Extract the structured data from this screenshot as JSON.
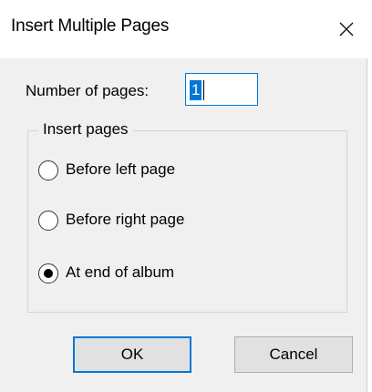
{
  "window": {
    "title": "Insert Multiple Pages",
    "close_icon": "close-icon"
  },
  "pages": {
    "label": "Number of pages:",
    "value": "1"
  },
  "group": {
    "legend": "Insert pages",
    "options": [
      {
        "label": "Before left page",
        "selected": false
      },
      {
        "label": "Before right page",
        "selected": false
      },
      {
        "label": "At end of album",
        "selected": true
      }
    ]
  },
  "buttons": {
    "ok_label": "OK",
    "cancel_label": "Cancel"
  },
  "colors": {
    "accent": "#0078d7",
    "dialog_bg": "#f0f0f0",
    "button_bg": "#e1e1e1"
  }
}
